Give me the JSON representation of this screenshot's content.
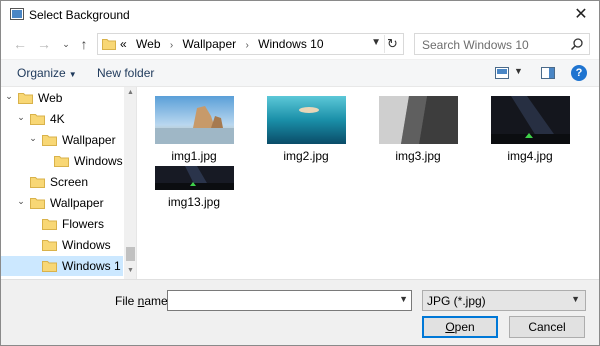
{
  "window": {
    "title": "Select Background",
    "close_icon": "close-icon"
  },
  "nav": {
    "back_icon": "back-arrow-icon",
    "forward_icon": "forward-arrow-icon",
    "recent_icon": "chevron-down-icon",
    "up_icon": "up-arrow-icon"
  },
  "address": {
    "overflow": "«",
    "crumbs": [
      "Web",
      "Wallpaper",
      "Windows 10"
    ],
    "separator": "›"
  },
  "search": {
    "placeholder": "Search Windows 10"
  },
  "toolbar": {
    "organize": "Organize",
    "new_folder": "New folder",
    "help": "?"
  },
  "tree": {
    "items": [
      {
        "label": "Web",
        "level": 2,
        "expanded": true,
        "selected": false
      },
      {
        "label": "4K",
        "level": 3,
        "expanded": true,
        "selected": false
      },
      {
        "label": "Wallpaper",
        "level": 4,
        "expanded": true,
        "selected": false
      },
      {
        "label": "Windows",
        "level": 5,
        "expanded": null,
        "selected": false
      },
      {
        "label": "Screen",
        "level": 3,
        "expanded": null,
        "selected": false
      },
      {
        "label": "Wallpaper",
        "level": 3,
        "expanded": true,
        "selected": false
      },
      {
        "label": "Flowers",
        "level": 4,
        "expanded": null,
        "selected": false
      },
      {
        "label": "Windows",
        "level": 4,
        "expanded": null,
        "selected": false
      },
      {
        "label": "Windows 1",
        "level": 4,
        "expanded": null,
        "selected": true
      }
    ]
  },
  "files": [
    {
      "name": "img1.jpg",
      "theme": "beach-rocks"
    },
    {
      "name": "img2.jpg",
      "theme": "underwater"
    },
    {
      "name": "img3.jpg",
      "theme": "rock-face"
    },
    {
      "name": "img4.jpg",
      "theme": "night-sky"
    },
    {
      "name": "img13.jpg",
      "theme": "night-panorama"
    }
  ],
  "bottom": {
    "filename_label_prefix": "File ",
    "filename_label_underlined": "n",
    "filename_label_suffix": "ame:",
    "filename_value": "",
    "filetype": "JPG (*.jpg)",
    "open_underlined": "O",
    "open_rest": "pen",
    "cancel": "Cancel"
  },
  "colors": {
    "selection": "#cce8ff",
    "accent": "#0078d7",
    "folder": "#f8d775"
  }
}
